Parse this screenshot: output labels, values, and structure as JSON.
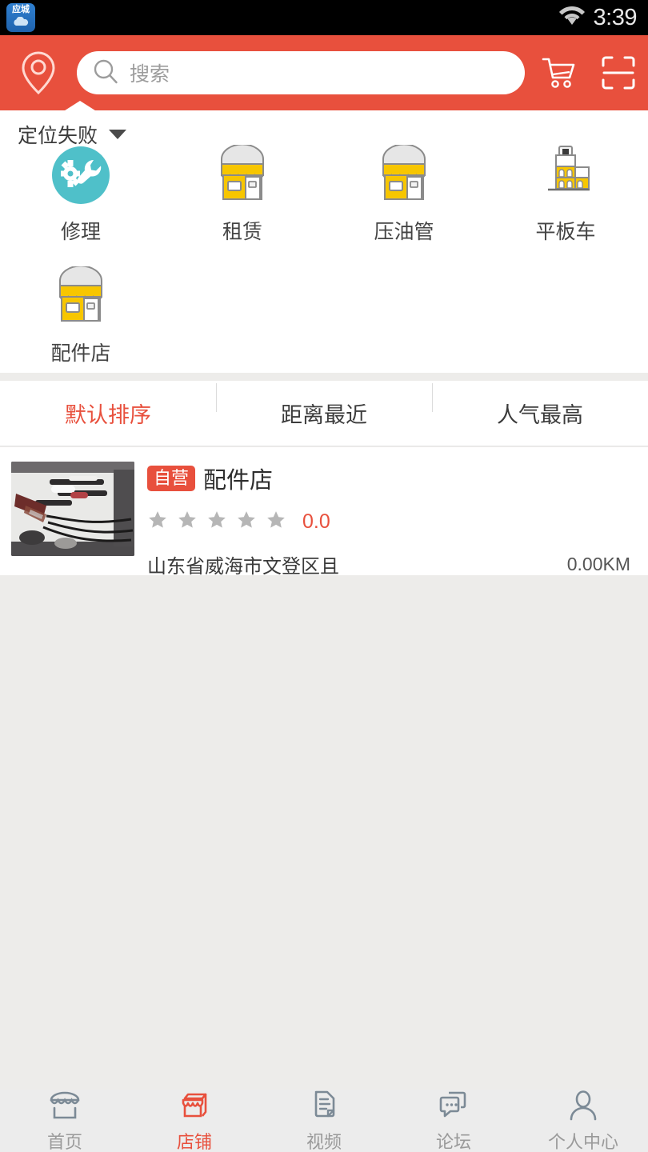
{
  "status_bar": {
    "app_icon_label": "应城",
    "time": "3:39",
    "wifi_icon": "wifi-icon"
  },
  "header": {
    "location_icon": "location-pin-icon",
    "search": {
      "icon": "search-icon",
      "value": "",
      "placeholder": "搜索"
    },
    "cart_icon": "shopping-cart-icon",
    "scan_icon": "scan-qr-icon",
    "accent_color": "#e8503d"
  },
  "location": {
    "label": "定位失败",
    "caret_icon": "chevron-down-icon"
  },
  "categories": [
    {
      "label": "修理",
      "icon": "repair-gear-wrench-icon",
      "color": "#4fc0c9"
    },
    {
      "label": "租赁",
      "icon": "shop-storefront-icon",
      "color": "#f7c600"
    },
    {
      "label": "压油管",
      "icon": "shop-storefront-icon",
      "color": "#f7c600"
    },
    {
      "label": "平板车",
      "icon": "building-tower-icon",
      "color": "#f7c600"
    },
    {
      "label": "配件店",
      "icon": "shop-storefront-icon",
      "color": "#f7c600"
    }
  ],
  "sort_tabs": [
    {
      "label": "默认排序",
      "active": true
    },
    {
      "label": "距离最近",
      "active": false
    },
    {
      "label": "人气最高",
      "active": false
    }
  ],
  "listings": [
    {
      "thumbnail": "store-photo-tools",
      "badge": "自营",
      "name": "配件店",
      "stars": 0,
      "star_total": 5,
      "score": "0.0",
      "address": "山东省威海市文登区且",
      "distance": "0.00KM"
    }
  ],
  "bottom_nav": [
    {
      "label": "首页",
      "icon": "home-storefront-icon",
      "active": false
    },
    {
      "label": "店铺",
      "icon": "shop-icon",
      "active": true
    },
    {
      "label": "视频",
      "icon": "document-page-icon",
      "active": false
    },
    {
      "label": "论坛",
      "icon": "chat-bubbles-icon",
      "active": false
    },
    {
      "label": "个人中心",
      "icon": "person-user-icon",
      "active": false
    }
  ]
}
